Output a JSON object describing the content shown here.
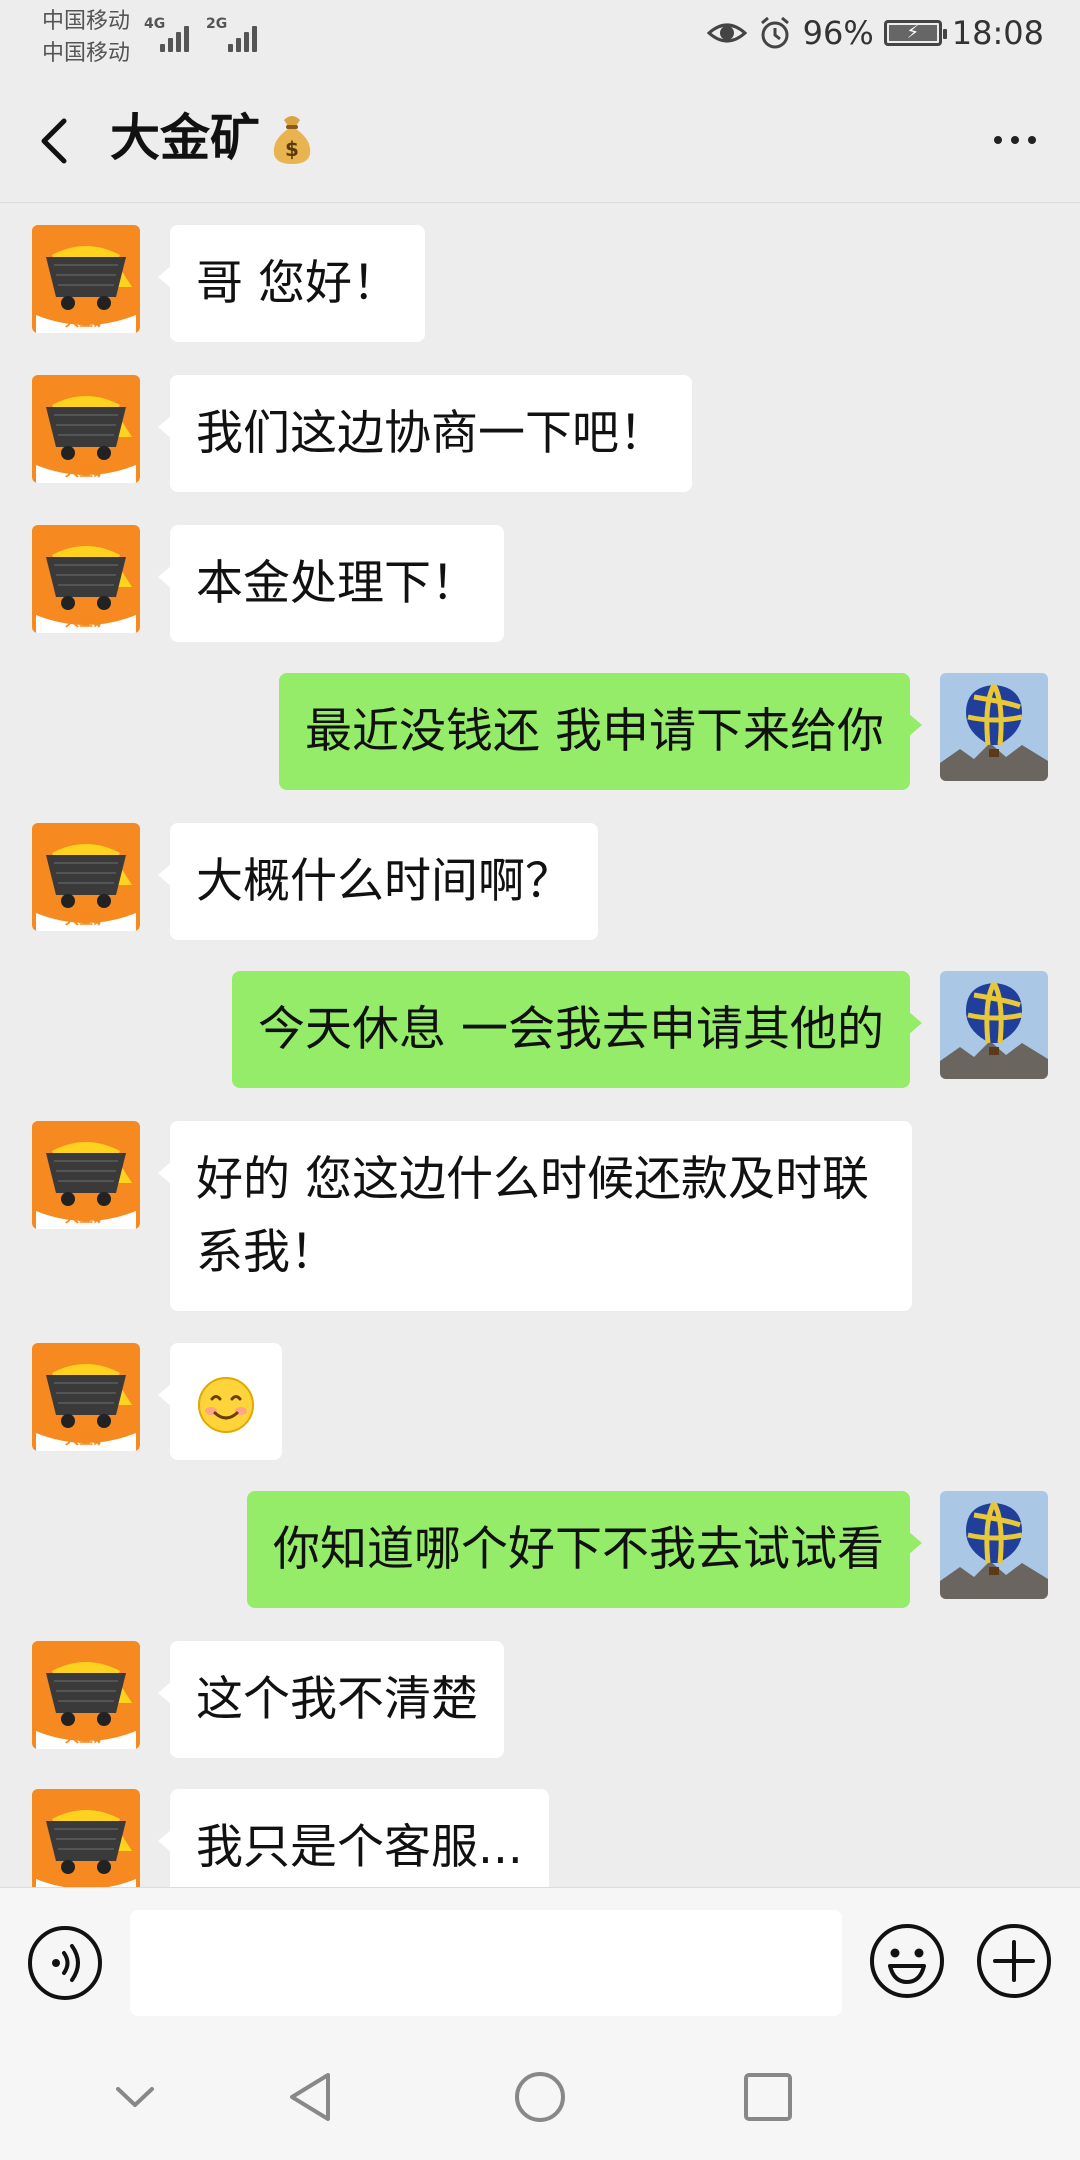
{
  "status_bar": {
    "carrier_1": "中国移动",
    "carrier_2": "中国移动",
    "network_1": "4G",
    "network_2": "2G",
    "battery": "96%",
    "time": "18:08"
  },
  "header": {
    "title": "大金矿",
    "title_icon": "money-bag-icon"
  },
  "contact_avatar_text": "大金矿",
  "messages": [
    {
      "side": "in",
      "text": "哥 您好！"
    },
    {
      "side": "in",
      "text": "我们这边协商一下吧！"
    },
    {
      "side": "in",
      "text": "本金处理下！"
    },
    {
      "side": "out",
      "text": "最近没钱还  我申请下来给你"
    },
    {
      "side": "in",
      "text": "大概什么时间啊？"
    },
    {
      "side": "out",
      "text": "今天休息  一会我去申请其他的"
    },
    {
      "side": "in",
      "text": "好的 您这边什么时候还款及时联系我！"
    },
    {
      "side": "in",
      "text": "",
      "emoji": "smiling-face-icon"
    },
    {
      "side": "out",
      "text": "你知道哪个好下不我去试试看"
    },
    {
      "side": "in",
      "text": "这个我不清楚"
    },
    {
      "side": "in",
      "text": "我只是个客服..."
    }
  ],
  "colors": {
    "background": "#ededed",
    "incoming_bubble": "#ffffff",
    "outgoing_bubble": "#95ec69"
  }
}
